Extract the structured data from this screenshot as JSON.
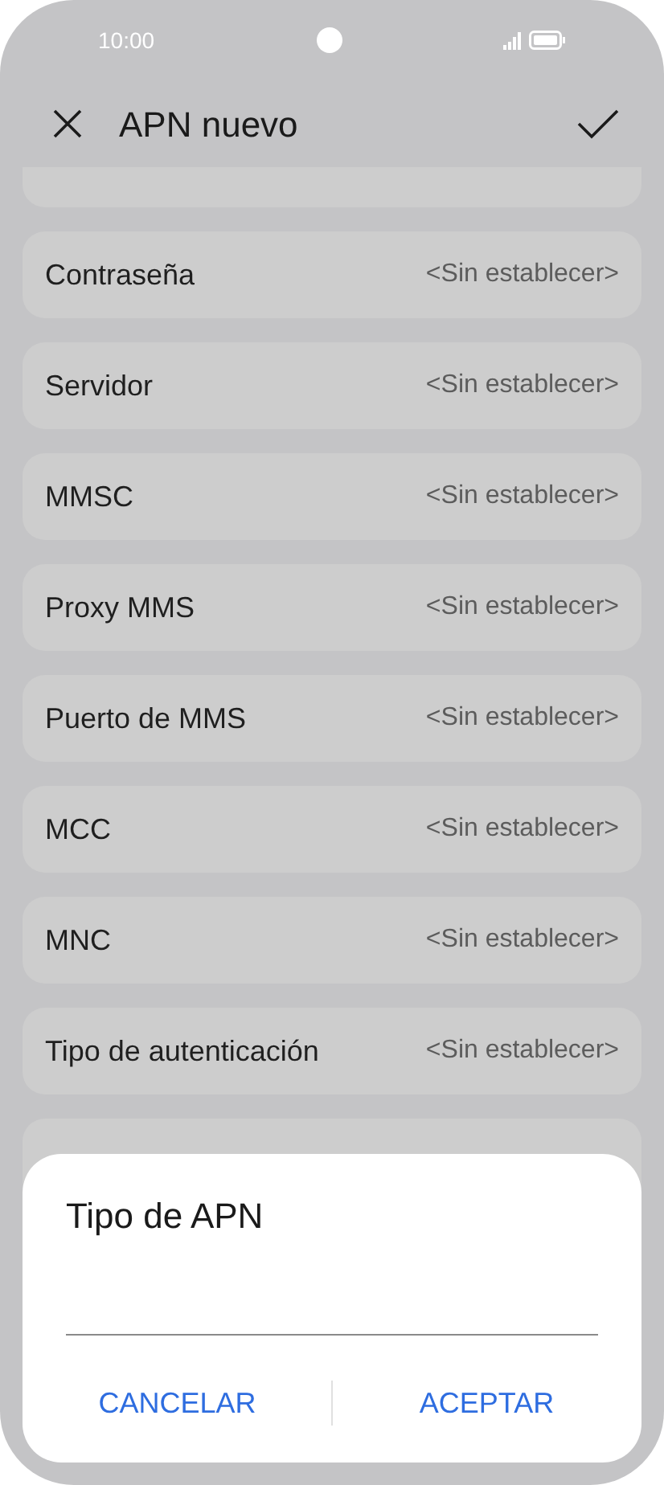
{
  "status_bar": {
    "time": "10:00"
  },
  "header": {
    "title": "APN nuevo"
  },
  "settings": [
    {
      "label": "Contraseña",
      "value": "<Sin establecer>"
    },
    {
      "label": "Servidor",
      "value": "<Sin establecer>"
    },
    {
      "label": "MMSC",
      "value": "<Sin establecer>"
    },
    {
      "label": "Proxy MMS",
      "value": "<Sin establecer>"
    },
    {
      "label": "Puerto de MMS",
      "value": "<Sin establecer>"
    },
    {
      "label": "MCC",
      "value": "<Sin establecer>"
    },
    {
      "label": "MNC",
      "value": "<Sin establecer>"
    },
    {
      "label": "Tipo de autenticación",
      "value": "<Sin establecer>"
    }
  ],
  "dialog": {
    "title": "Tipo de APN",
    "buttons": [
      "CANCELAR",
      "ACEPTAR"
    ]
  }
}
